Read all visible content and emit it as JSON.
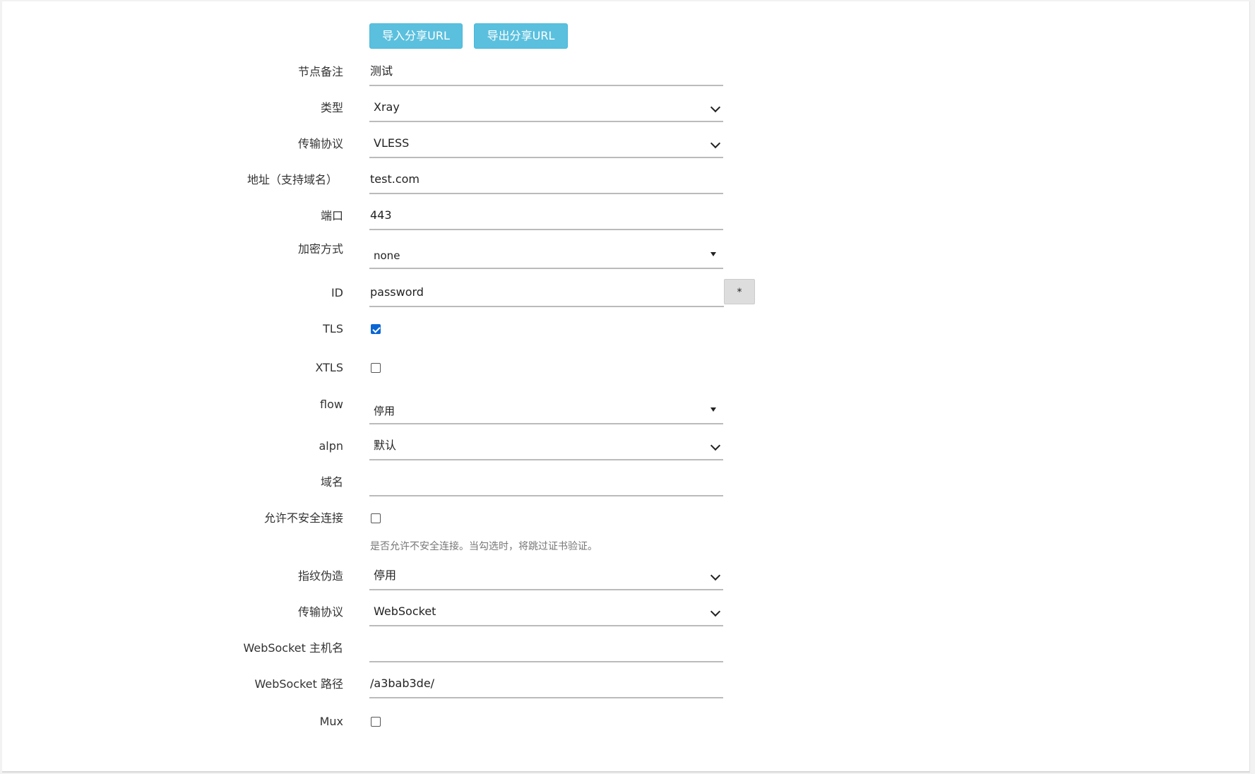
{
  "buttons": {
    "import_url": "导入分享URL",
    "export_url": "导出分享URL"
  },
  "form": {
    "remark": {
      "label": "节点备注",
      "value": "测试"
    },
    "type": {
      "label": "类型",
      "value": "Xray"
    },
    "protocol": {
      "label": "传输协议",
      "value": "VLESS"
    },
    "address": {
      "label": "地址（支持域名）",
      "value": "test.com"
    },
    "port": {
      "label": "端口",
      "value": "443"
    },
    "encryption": {
      "label": "加密方式",
      "value": "none"
    },
    "id": {
      "label": "ID",
      "value": "password",
      "button": "*"
    },
    "tls": {
      "label": "TLS",
      "checked": true
    },
    "xtls": {
      "label": "XTLS",
      "checked": false
    },
    "flow": {
      "label": "flow",
      "value": "停用"
    },
    "alpn": {
      "label": "alpn",
      "value": "默认"
    },
    "domain": {
      "label": "域名",
      "value": ""
    },
    "insecure": {
      "label": "允许不安全连接",
      "checked": false,
      "hint": "是否允许不安全连接。当勾选时，将跳过证书验证。"
    },
    "fingerprint": {
      "label": "指纹伪造",
      "value": "停用"
    },
    "transport": {
      "label": "传输协议",
      "value": "WebSocket"
    },
    "ws_host": {
      "label": "WebSocket 主机名",
      "value": ""
    },
    "ws_path": {
      "label": "WebSocket 路径",
      "value": "/a3bab3de/"
    },
    "mux": {
      "label": "Mux",
      "checked": false
    }
  },
  "colors": {
    "button_bg": "#5bc0de",
    "checkbox_checked": "#0b66d4"
  },
  "icons": {
    "select_arrow": "chevron-down-icon",
    "dropdown_arrow": "caret-down-icon"
  }
}
